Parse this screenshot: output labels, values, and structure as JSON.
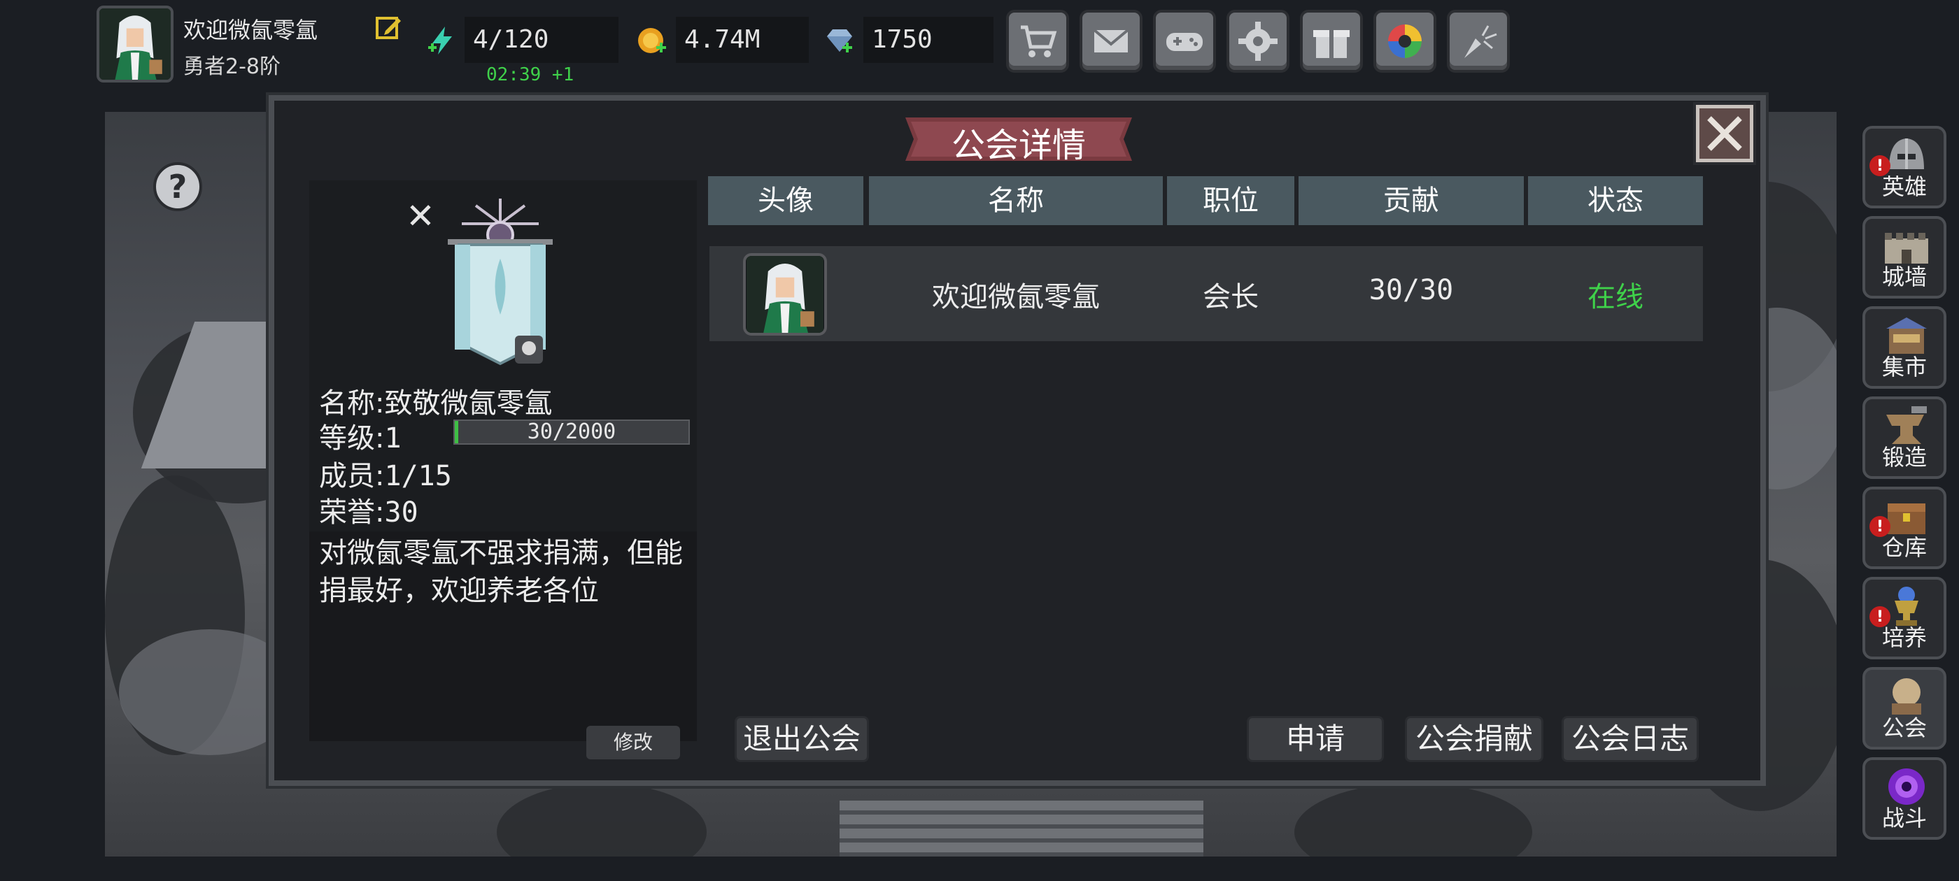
{
  "player": {
    "name": "欢迎微氤零氲",
    "rank": "勇者2-8阶"
  },
  "resources": {
    "energy": "4/120",
    "energy_timer": "02:39 +1",
    "gold": "4.74M",
    "gems": "1750"
  },
  "top_buttons": [
    "shop-cart-icon",
    "mail-icon",
    "gamepad-icon",
    "settings-gear-icon",
    "gift-icon",
    "color-wheel-icon",
    "fireworks-icon"
  ],
  "sidebar": {
    "items": [
      {
        "label": "英雄",
        "alert": "!"
      },
      {
        "label": "城墙",
        "alert": ""
      },
      {
        "label": "集市",
        "alert": ""
      },
      {
        "label": "锻造",
        "alert": ""
      },
      {
        "label": "仓库",
        "alert": "!"
      },
      {
        "label": "培养",
        "alert": "!"
      },
      {
        "label": "公会",
        "alert": ""
      },
      {
        "label": "战斗",
        "alert": ""
      }
    ]
  },
  "dialog": {
    "title": "公会详情",
    "help": "?",
    "close": "✕"
  },
  "guild": {
    "name_label": "名称:",
    "name": "致敬微氤零氲",
    "level_label": "等级:",
    "level": "1",
    "xp": "30/2000",
    "xp_fraction": 0.015,
    "members_label": "成员:",
    "members": "1/15",
    "honor_label": "荣誉:",
    "honor": "30",
    "description": "对微氤零氲不强求捐满，但能捐最好，欢迎养老各位",
    "modify_label": "修改",
    "panel_close": "✕"
  },
  "table": {
    "headers": [
      "头像",
      "名称",
      "职位",
      "贡献",
      "状态"
    ],
    "rows": [
      {
        "name": "欢迎微氤零氲",
        "position": "会长",
        "contribution": "30/30",
        "status": "在线"
      }
    ]
  },
  "actions": {
    "leave": "退出公会",
    "apply": "申请",
    "donate": "公会捐献",
    "log": "公会日志"
  },
  "colors": {
    "online": "#3fd14a",
    "header_bg": "#4a5960",
    "dialog_bg": "#202226"
  }
}
